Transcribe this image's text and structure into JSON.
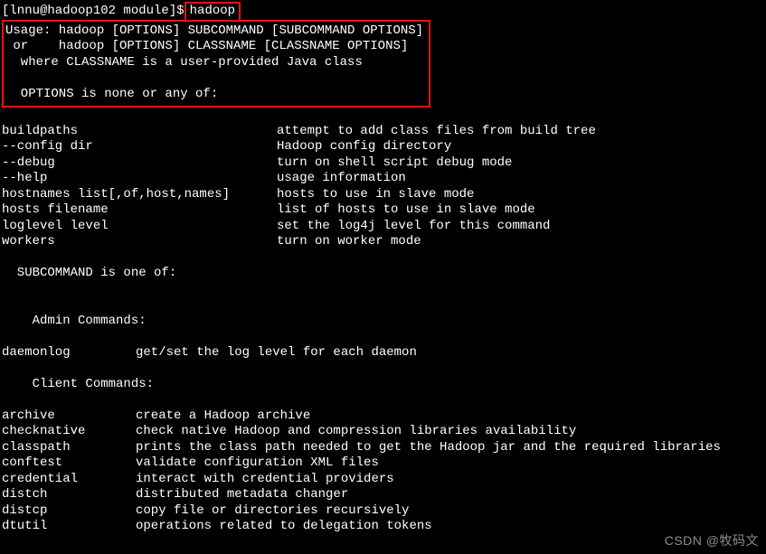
{
  "prompt": {
    "user_host": "[lnnu@hadoop102 module]$",
    "command": " hadoop "
  },
  "usage": {
    "line1": "Usage: hadoop [OPTIONS] SUBCOMMAND [SUBCOMMAND OPTIONS]",
    "line2": " or    hadoop [OPTIONS] CLASSNAME [CLASSNAME OPTIONS]",
    "line3": "  where CLASSNAME is a user-provided Java class",
    "blank": " ",
    "line4": "  OPTIONS is none or any of:"
  },
  "options": [
    {
      "name": "buildpaths",
      "desc": "attempt to add class files from build tree"
    },
    {
      "name": "--config dir",
      "desc": "Hadoop config directory"
    },
    {
      "name": "--debug",
      "desc": "turn on shell script debug mode"
    },
    {
      "name": "--help",
      "desc": "usage information"
    },
    {
      "name": "hostnames list[,of,host,names]",
      "desc": "hosts to use in slave mode"
    },
    {
      "name": "hosts filename",
      "desc": "list of hosts to use in slave mode"
    },
    {
      "name": "loglevel level",
      "desc": "set the log4j level for this command"
    },
    {
      "name": "workers",
      "desc": "turn on worker mode"
    }
  ],
  "subcmd_header": "  SUBCOMMAND is one of:",
  "admin_header": "    Admin Commands:",
  "admin_commands": [
    {
      "name": "daemonlog",
      "desc": "get/set the log level for each daemon"
    }
  ],
  "client_header": "    Client Commands:",
  "client_commands": [
    {
      "name": "archive",
      "desc": "create a Hadoop archive"
    },
    {
      "name": "checknative",
      "desc": "check native Hadoop and compression libraries availability"
    },
    {
      "name": "classpath",
      "desc": "prints the class path needed to get the Hadoop jar and the required libraries"
    },
    {
      "name": "conftest",
      "desc": "validate configuration XML files"
    },
    {
      "name": "credential",
      "desc": "interact with credential providers"
    },
    {
      "name": "distch",
      "desc": "distributed metadata changer"
    },
    {
      "name": "distcp",
      "desc": "copy file or directories recursively"
    },
    {
      "name": "dtutil",
      "desc": "operations related to delegation tokens"
    }
  ],
  "watermark": "CSDN @牧码文"
}
